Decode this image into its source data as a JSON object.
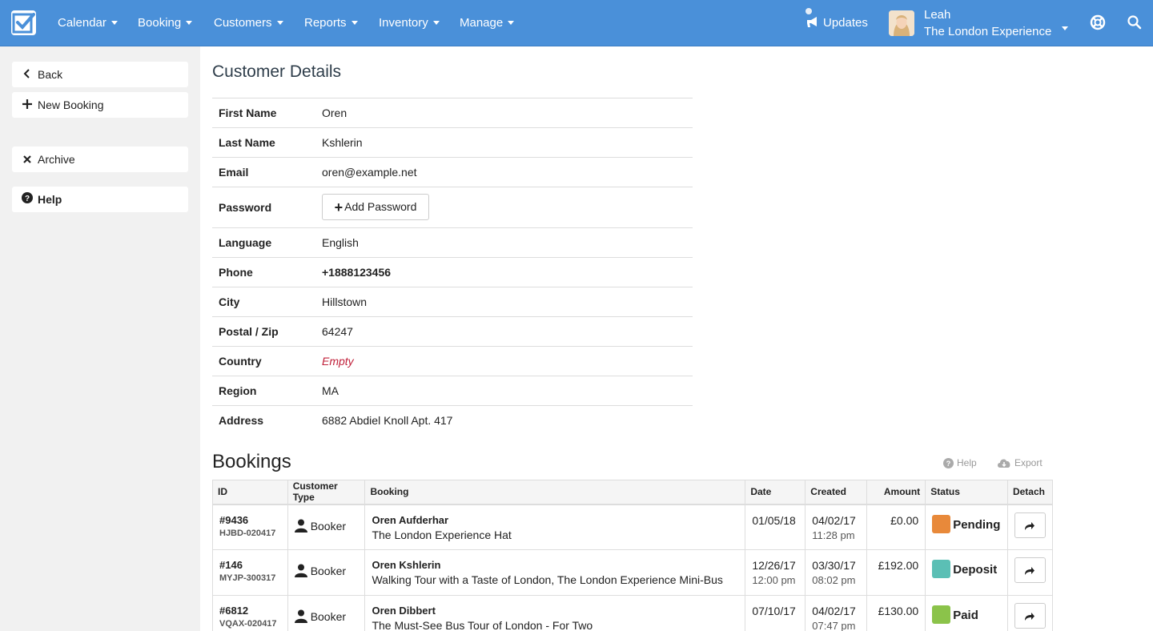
{
  "nav": {
    "items": [
      {
        "label": "Calendar"
      },
      {
        "label": "Booking"
      },
      {
        "label": "Customers"
      },
      {
        "label": "Reports"
      },
      {
        "label": "Inventory"
      },
      {
        "label": "Manage"
      }
    ],
    "updates_label": "Updates",
    "user_name": "Leah",
    "user_company": "The London Experience"
  },
  "sidebar": {
    "back": "Back",
    "new_booking": "New Booking",
    "archive": "Archive",
    "help": "Help"
  },
  "details": {
    "title": "Customer Details",
    "rows": [
      {
        "label": "First Name",
        "value": "Oren"
      },
      {
        "label": "Last Name",
        "value": "Kshlerin"
      },
      {
        "label": "Email",
        "value": "oren@example.net"
      },
      {
        "label": "Password",
        "button": "Add Password"
      },
      {
        "label": "Language",
        "value": "English"
      },
      {
        "label": "Phone",
        "value": "+1888123456"
      },
      {
        "label": "City",
        "value": "Hillstown"
      },
      {
        "label": "Postal / Zip",
        "value": "64247"
      },
      {
        "label": "Country",
        "value": "Empty"
      },
      {
        "label": "Region",
        "value": "MA"
      },
      {
        "label": "Address",
        "value": "6882 Abdiel Knoll Apt. 417"
      }
    ]
  },
  "bookings": {
    "title": "Bookings",
    "help": "Help",
    "export": "Export",
    "columns": [
      "ID",
      "Customer Type",
      "Booking",
      "Date",
      "Created",
      "Amount",
      "Status",
      "Detach"
    ],
    "rows": [
      {
        "id": "#9436",
        "code": "HJBD-020417",
        "type": "Booker",
        "name": "Oren Aufderhar",
        "desc": "The London Experience Hat",
        "date": "01/05/18",
        "time": "",
        "created": "04/02/17",
        "created_time": "11:28 pm",
        "amount": "£0.00",
        "status": "Pending",
        "status_color": "#e8893a"
      },
      {
        "id": "#146",
        "code": "MYJP-300317",
        "type": "Booker",
        "name": "Oren Kshlerin",
        "desc": "Walking Tour with a Taste of London, The London Experience Mini-Bus",
        "date": "12/26/17",
        "time": "12:00 pm",
        "created": "03/30/17",
        "created_time": "08:02 pm",
        "amount": "£192.00",
        "status": "Deposit",
        "status_color": "#5bbfb5"
      },
      {
        "id": "#6812",
        "code": "VQAX-020417",
        "type": "Booker",
        "name": "Oren Dibbert",
        "desc": "The Must-See Bus Tour of London - For Two",
        "date": "07/10/17",
        "time": "",
        "created": "04/02/17",
        "created_time": "07:47 pm",
        "amount": "£130.00",
        "status": "Paid",
        "status_color": "#8bc34a"
      }
    ]
  }
}
